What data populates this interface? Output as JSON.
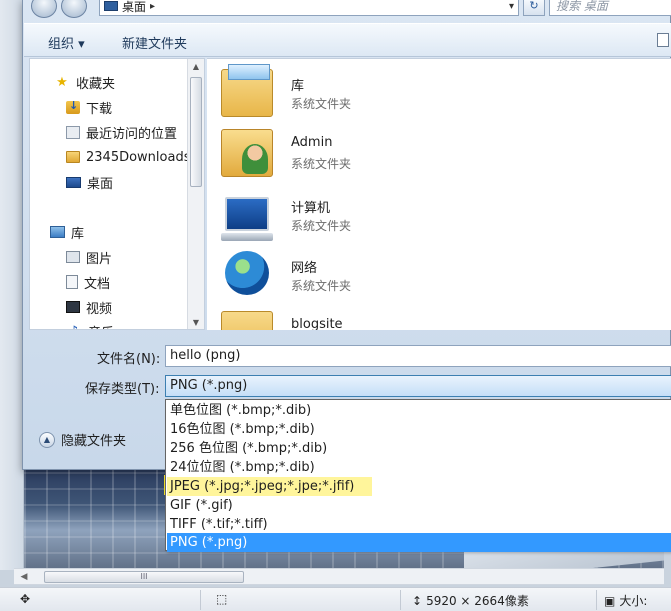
{
  "address": {
    "location": "桌面",
    "search_placeholder": "搜索 桌面"
  },
  "toolbar": {
    "organize_label": "组织 ▾",
    "new_folder_label": "新建文件夹"
  },
  "nav": {
    "favorites_label": "收藏夹",
    "items": [
      {
        "label": "下载",
        "icon": "download-folder-icon"
      },
      {
        "label": "最近访问的位置",
        "icon": "recent-places-icon"
      },
      {
        "label": "2345Downloads",
        "icon": "folder-icon"
      },
      {
        "label": "桌面",
        "icon": "desktop-icon"
      }
    ],
    "libraries_label": "库",
    "lib_items": [
      {
        "label": "图片",
        "icon": "pictures-icon"
      },
      {
        "label": "文档",
        "icon": "documents-icon"
      },
      {
        "label": "视频",
        "icon": "videos-icon"
      },
      {
        "label": "音乐",
        "icon": "music-icon"
      }
    ]
  },
  "files": [
    {
      "name": "库",
      "sub": "系统文件夹",
      "icon": "library-folder-icon"
    },
    {
      "name": "Admin",
      "sub": "系统文件夹",
      "icon": "user-folder-icon"
    },
    {
      "name": "计算机",
      "sub": "系统文件夹",
      "icon": "computer-icon"
    },
    {
      "name": "网络",
      "sub": "系统文件夹",
      "icon": "network-icon"
    },
    {
      "name": "blogsite",
      "sub": "",
      "icon": "folder-icon"
    }
  ],
  "form": {
    "filename_label": "文件名(N):",
    "filename_value": "hello (png)",
    "filetype_label": "保存类型(T):",
    "filetype_value": "PNG (*.png)",
    "hide_folders_label": "隐藏文件夹"
  },
  "filetype_options": [
    "单色位图 (*.bmp;*.dib)",
    "16色位图 (*.bmp;*.dib)",
    "256 色位图 (*.bmp;*.dib)",
    "24位位图 (*.bmp;*.dib)",
    "JPEG (*.jpg;*.jpeg;*.jpe;*.jfif)",
    "GIF (*.gif)",
    "TIFF (*.tif;*.tiff)",
    "PNG (*.png)"
  ],
  "selected_option_index": 7,
  "highlighted_option_index": 4,
  "statusbar": {
    "dimensions": "5920 × 2664像素",
    "size_label": "大小:"
  },
  "colors": {
    "selection": "#3399ff",
    "highlight": "#fff38a"
  }
}
